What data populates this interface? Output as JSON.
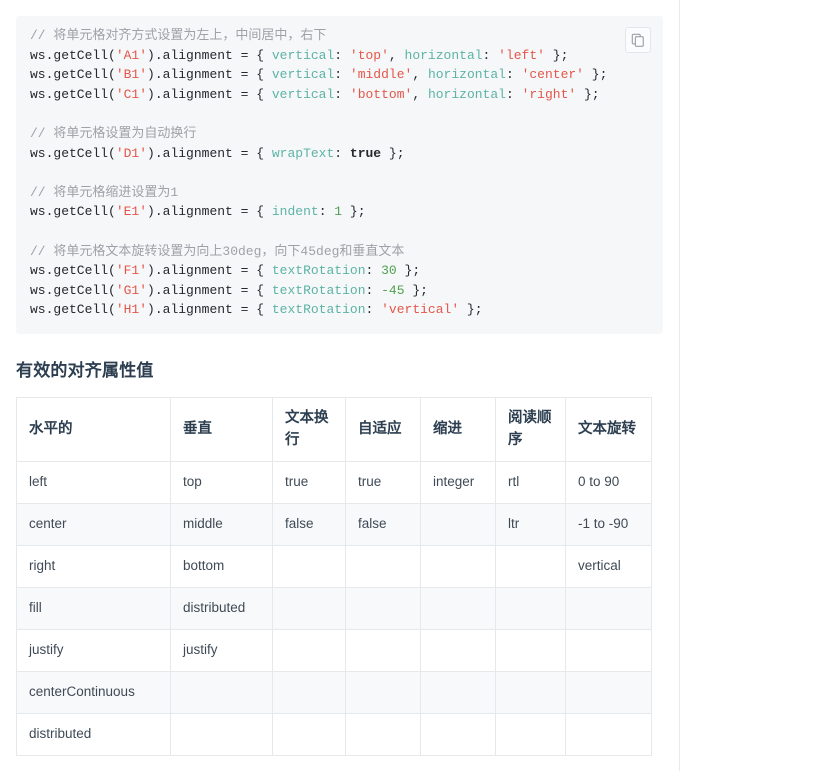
{
  "code_block": {
    "copy_icon": "copy-icon",
    "language": "javascript",
    "lines": [
      [
        {
          "t": "// 将单元格对齐方式设置为左上，中间居中，右下",
          "c": "cm"
        }
      ],
      [
        {
          "t": "ws.getCell(",
          "c": "pl"
        },
        {
          "t": "'A1'",
          "c": "str"
        },
        {
          "t": ").alignment = { ",
          "c": "pl"
        },
        {
          "t": "vertical",
          "c": "prop"
        },
        {
          "t": ": ",
          "c": "pl"
        },
        {
          "t": "'top'",
          "c": "str"
        },
        {
          "t": ", ",
          "c": "pl"
        },
        {
          "t": "horizontal",
          "c": "prop"
        },
        {
          "t": ": ",
          "c": "pl"
        },
        {
          "t": "'left'",
          "c": "str"
        },
        {
          "t": " };",
          "c": "pl"
        }
      ],
      [
        {
          "t": "ws.getCell(",
          "c": "pl"
        },
        {
          "t": "'B1'",
          "c": "str"
        },
        {
          "t": ").alignment = { ",
          "c": "pl"
        },
        {
          "t": "vertical",
          "c": "prop"
        },
        {
          "t": ": ",
          "c": "pl"
        },
        {
          "t": "'middle'",
          "c": "str"
        },
        {
          "t": ", ",
          "c": "pl"
        },
        {
          "t": "horizontal",
          "c": "prop"
        },
        {
          "t": ": ",
          "c": "pl"
        },
        {
          "t": "'center'",
          "c": "str"
        },
        {
          "t": " };",
          "c": "pl"
        }
      ],
      [
        {
          "t": "ws.getCell(",
          "c": "pl"
        },
        {
          "t": "'C1'",
          "c": "str"
        },
        {
          "t": ").alignment = { ",
          "c": "pl"
        },
        {
          "t": "vertical",
          "c": "prop"
        },
        {
          "t": ": ",
          "c": "pl"
        },
        {
          "t": "'bottom'",
          "c": "str"
        },
        {
          "t": ", ",
          "c": "pl"
        },
        {
          "t": "horizontal",
          "c": "prop"
        },
        {
          "t": ": ",
          "c": "pl"
        },
        {
          "t": "'right'",
          "c": "str"
        },
        {
          "t": " };",
          "c": "pl"
        }
      ],
      [],
      [
        {
          "t": "// 将单元格设置为自动换行",
          "c": "cm"
        }
      ],
      [
        {
          "t": "ws.getCell(",
          "c": "pl"
        },
        {
          "t": "'D1'",
          "c": "str"
        },
        {
          "t": ").alignment = { ",
          "c": "pl"
        },
        {
          "t": "wrapText",
          "c": "prop"
        },
        {
          "t": ": ",
          "c": "pl"
        },
        {
          "t": "true",
          "c": "bool"
        },
        {
          "t": " };",
          "c": "pl"
        }
      ],
      [],
      [
        {
          "t": "// 将单元格缩进设置为1",
          "c": "cm"
        }
      ],
      [
        {
          "t": "ws.getCell(",
          "c": "pl"
        },
        {
          "t": "'E1'",
          "c": "str"
        },
        {
          "t": ").alignment = { ",
          "c": "pl"
        },
        {
          "t": "indent",
          "c": "prop"
        },
        {
          "t": ": ",
          "c": "pl"
        },
        {
          "t": "1",
          "c": "num"
        },
        {
          "t": " };",
          "c": "pl"
        }
      ],
      [],
      [
        {
          "t": "// 将单元格文本旋转设置为向上30deg，向下45deg和垂直文本",
          "c": "cm"
        }
      ],
      [
        {
          "t": "ws.getCell(",
          "c": "pl"
        },
        {
          "t": "'F1'",
          "c": "str"
        },
        {
          "t": ").alignment = { ",
          "c": "pl"
        },
        {
          "t": "textRotation",
          "c": "prop"
        },
        {
          "t": ": ",
          "c": "pl"
        },
        {
          "t": "30",
          "c": "num"
        },
        {
          "t": " };",
          "c": "pl"
        }
      ],
      [
        {
          "t": "ws.getCell(",
          "c": "pl"
        },
        {
          "t": "'G1'",
          "c": "str"
        },
        {
          "t": ").alignment = { ",
          "c": "pl"
        },
        {
          "t": "textRotation",
          "c": "prop"
        },
        {
          "t": ": ",
          "c": "pl"
        },
        {
          "t": "-45",
          "c": "num"
        },
        {
          "t": " };",
          "c": "pl"
        }
      ],
      [
        {
          "t": "ws.getCell(",
          "c": "pl"
        },
        {
          "t": "'H1'",
          "c": "str"
        },
        {
          "t": ").alignment = { ",
          "c": "pl"
        },
        {
          "t": "textRotation",
          "c": "prop"
        },
        {
          "t": ": ",
          "c": "pl"
        },
        {
          "t": "'vertical'",
          "c": "str"
        },
        {
          "t": " };",
          "c": "pl"
        }
      ]
    ]
  },
  "section": {
    "title": "有效的对齐属性值"
  },
  "table": {
    "headers": [
      "水平的",
      "垂直",
      "文本换行",
      "自适应",
      "缩进",
      "阅读顺序",
      "文本旋转"
    ],
    "rows": [
      [
        "left",
        "top",
        "true",
        "true",
        "integer",
        "rtl",
        "0 to 90"
      ],
      [
        "center",
        "middle",
        "false",
        "false",
        "",
        "ltr",
        "-1 to -90"
      ],
      [
        "right",
        "bottom",
        "",
        "",
        "",
        "",
        "vertical"
      ],
      [
        "fill",
        "distributed",
        "",
        "",
        "",
        "",
        ""
      ],
      [
        "justify",
        "justify",
        "",
        "",
        "",
        "",
        ""
      ],
      [
        "centerContinuous",
        "",
        "",
        "",
        "",
        "",
        ""
      ],
      [
        "distributed",
        "",
        "",
        "",
        "",
        "",
        ""
      ]
    ]
  },
  "colors": {
    "code_background": "#f6f7f9",
    "comment": "#a0a1a7",
    "string": "#e45649",
    "property": "#5cb3a6",
    "number": "#50a14f",
    "plain": "#24292e",
    "table_border": "#e6e9ec",
    "row_stripe": "#f8f9fa",
    "divider": "#e9e9ec"
  }
}
